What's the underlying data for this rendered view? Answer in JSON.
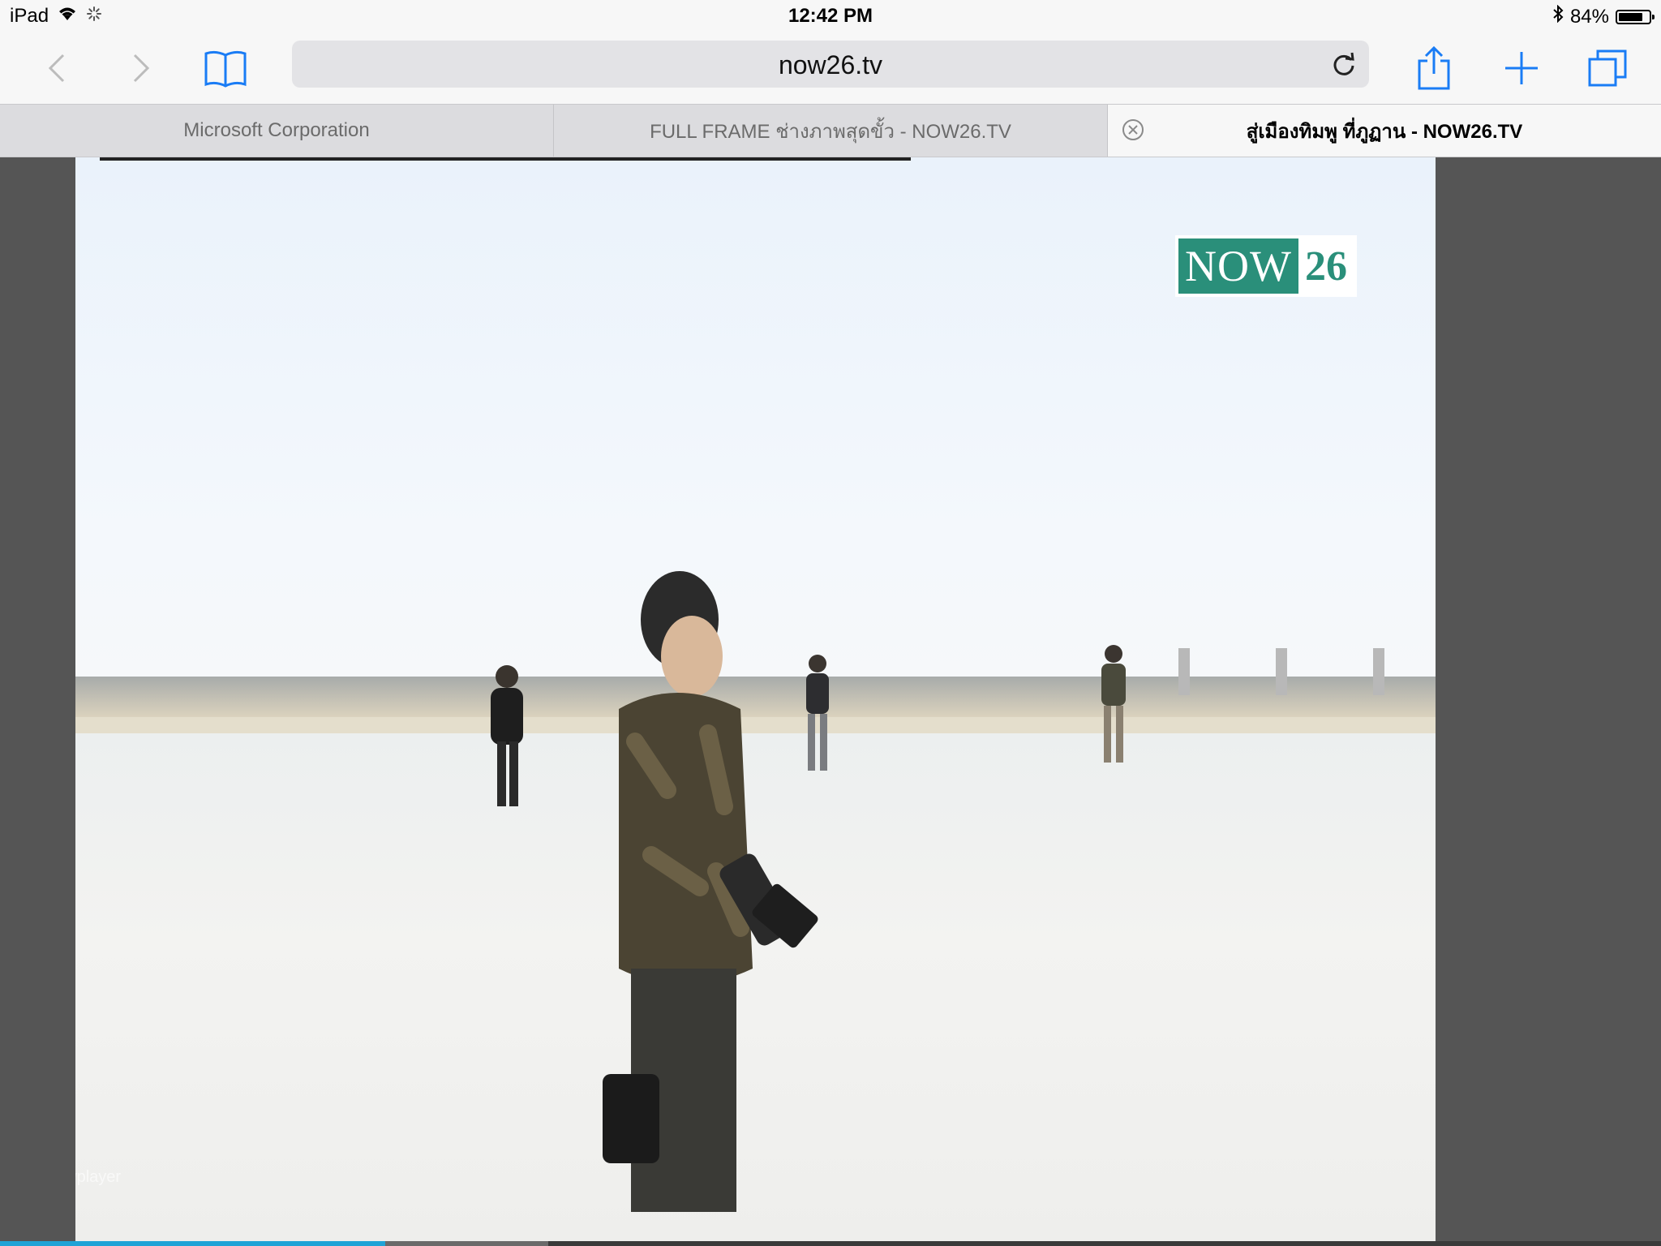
{
  "status_bar": {
    "device": "iPad",
    "time": "12:42 PM",
    "battery": "84%",
    "battery_level": 0.84
  },
  "toolbar": {
    "url": "now26.tv"
  },
  "tabs": [
    {
      "label": "Microsoft Corporation",
      "active": false
    },
    {
      "label": "FULL FRAME ช่างภาพสุดขั้ว - NOW26.TV",
      "active": false
    },
    {
      "label": "สู่เมืองทิมพู ที่ภูฏาน - NOW26.TV",
      "active": true
    }
  ],
  "video": {
    "logo_text": "NOW",
    "logo_number": "26",
    "watermark": "flowplayer",
    "progress_played": 0.232,
    "progress_buffered": 0.33
  },
  "colors": {
    "accent": "#1a7cf5",
    "logo_green": "#2a8f7a",
    "progress": "#1fa3d6"
  }
}
